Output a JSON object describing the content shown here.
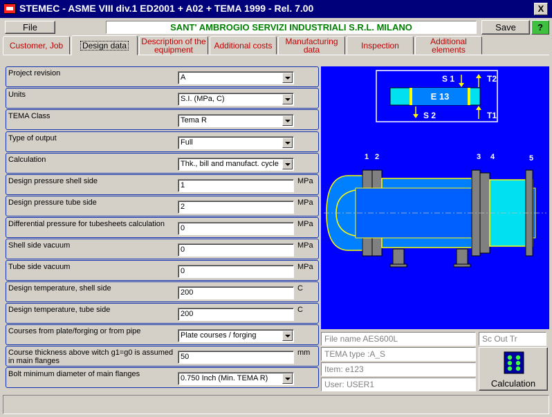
{
  "window": {
    "title": "STEMEC - ASME VIII div.1 ED2001 + A02 + TEMA 1999 - Rel. 7.00",
    "close_label": "X"
  },
  "toolbar": {
    "file_label": "File",
    "company": "SANT' AMBROGIO SERVIZI INDUSTRIALI S.R.L.  MILANO",
    "save_label": "Save",
    "help_label": "?"
  },
  "tabs": [
    {
      "label": "Customer, Job"
    },
    {
      "label": "Design data"
    },
    {
      "label": "Description of the equipment"
    },
    {
      "label": "Additional costs"
    },
    {
      "label": "Manufacturing data"
    },
    {
      "label": "Inspection"
    },
    {
      "label": "Additional elements"
    }
  ],
  "fields": [
    {
      "label": "Project revision",
      "value": "A",
      "unit": ""
    },
    {
      "label": "Units",
      "value": "S.I.   (MPa, C)",
      "unit": ""
    },
    {
      "label": "TEMA Class",
      "value": "Tema R",
      "unit": ""
    },
    {
      "label": "Type of output",
      "value": "Full",
      "unit": ""
    },
    {
      "label": "Calculation",
      "value": "Thk., bill and manufact. cycle",
      "unit": ""
    },
    {
      "label": "Design pressure shell side",
      "value": "1",
      "unit": "MPa"
    },
    {
      "label": "Design pressure tube side",
      "value": "2",
      "unit": "MPa"
    },
    {
      "label": "Differential pressure for tubesheets calculation",
      "value": "0",
      "unit": "MPa"
    },
    {
      "label": "Shell side vacuum",
      "value": "0",
      "unit": "MPa"
    },
    {
      "label": "Tube side vacuum",
      "value": "0",
      "unit": "MPa"
    },
    {
      "label": "Design temperature, shell side",
      "value": "200",
      "unit": "C"
    },
    {
      "label": "Design temperature, tube side",
      "value": "200",
      "unit": "C"
    },
    {
      "label": "Courses from plate/forging or from pipe",
      "value": "Plate courses / forging",
      "unit": ""
    },
    {
      "label": "Course thickness above witch g1=g0 is assumed in main flanges",
      "value": "50",
      "unit": "mm"
    },
    {
      "label": "Bolt minimum diameter of main flanges",
      "value": "0.750 Inch (Min. TEMA R)",
      "unit": ""
    }
  ],
  "drawing": {
    "unit_label": "E 13",
    "s1": "S 1",
    "s2": "S 2",
    "t1": "T1",
    "t2": "T2",
    "n1": "1",
    "n2": "2",
    "n3": "3",
    "n4": "4",
    "n5": "5"
  },
  "info": {
    "file_name": "File name   AES600L",
    "sc_out": "Sc  Out  Tr",
    "tema_type": "TEMA type :A_S",
    "item": "Item:  e123",
    "user": "User:   USER1"
  },
  "calc_label": "Calculation",
  "colors": {
    "title_bar": "#00007b",
    "drawing_bg": "#0000ff",
    "company_text": "#008000",
    "tab_text": "#c00000",
    "help_button": "#40c040"
  }
}
